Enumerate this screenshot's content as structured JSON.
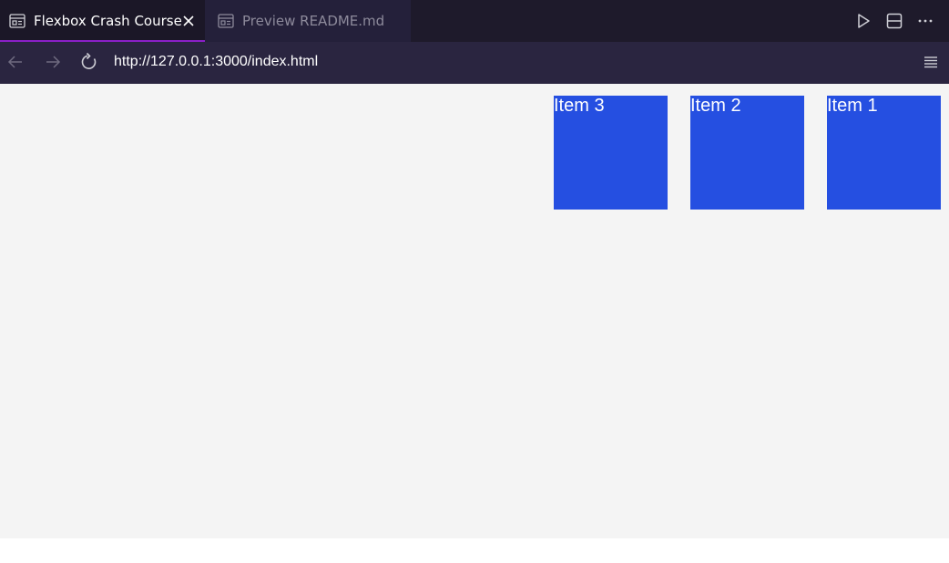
{
  "tabs": [
    {
      "label": "Flexbox Crash Course",
      "active": true,
      "icon": "preview-icon"
    },
    {
      "label": "Preview README.md",
      "active": false,
      "icon": "preview-icon"
    }
  ],
  "toolbar_icons": [
    "run-icon",
    "split-editor-icon",
    "more-icon"
  ],
  "navigation": {
    "url": "http://127.0.0.1:3000/index.html",
    "icons": [
      "back-arrow-icon",
      "forward-arrow-icon",
      "reload-icon",
      "menu-icon"
    ]
  },
  "page": {
    "items": [
      {
        "label": "Item 1"
      },
      {
        "label": "Item 2"
      },
      {
        "label": "Item 3"
      }
    ]
  },
  "colors": {
    "accent": "#8a1fc7",
    "item_bg": "#254fe1",
    "page_bg": "#f4f4f4",
    "tabbar_bg": "#1e1a2b",
    "navbar_bg": "#2a2540"
  }
}
